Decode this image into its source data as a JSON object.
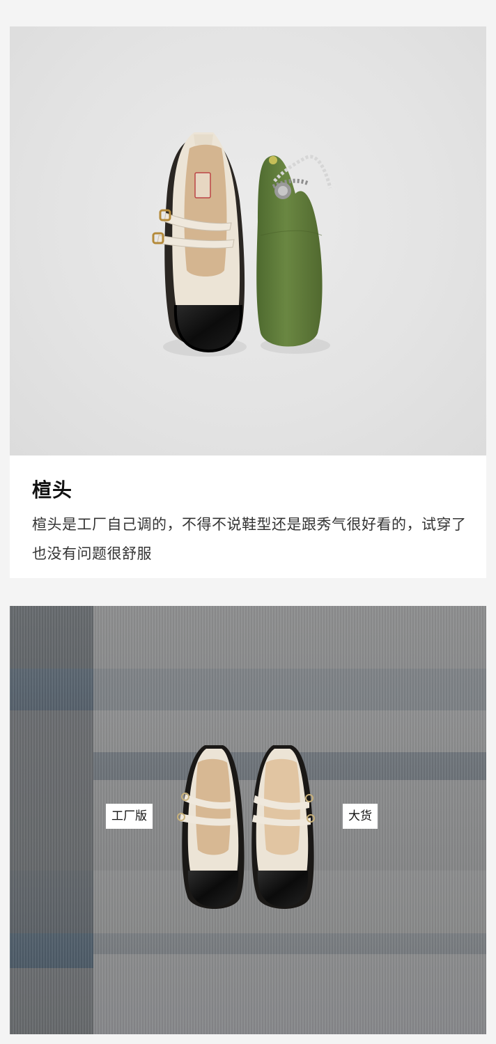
{
  "section": {
    "title": "楦头",
    "description": "楦头是工厂自己调的，不得不说鞋型还是跟秀气很好看的，试穿了也没有问题很舒服"
  },
  "comparison": {
    "left_label": "工厂版",
    "right_label": "大货"
  },
  "colors": {
    "shoe_cream": "#ece4d6",
    "shoe_black": "#141414",
    "last_green": "#5f7a3a",
    "card_white": "#ffffff"
  }
}
